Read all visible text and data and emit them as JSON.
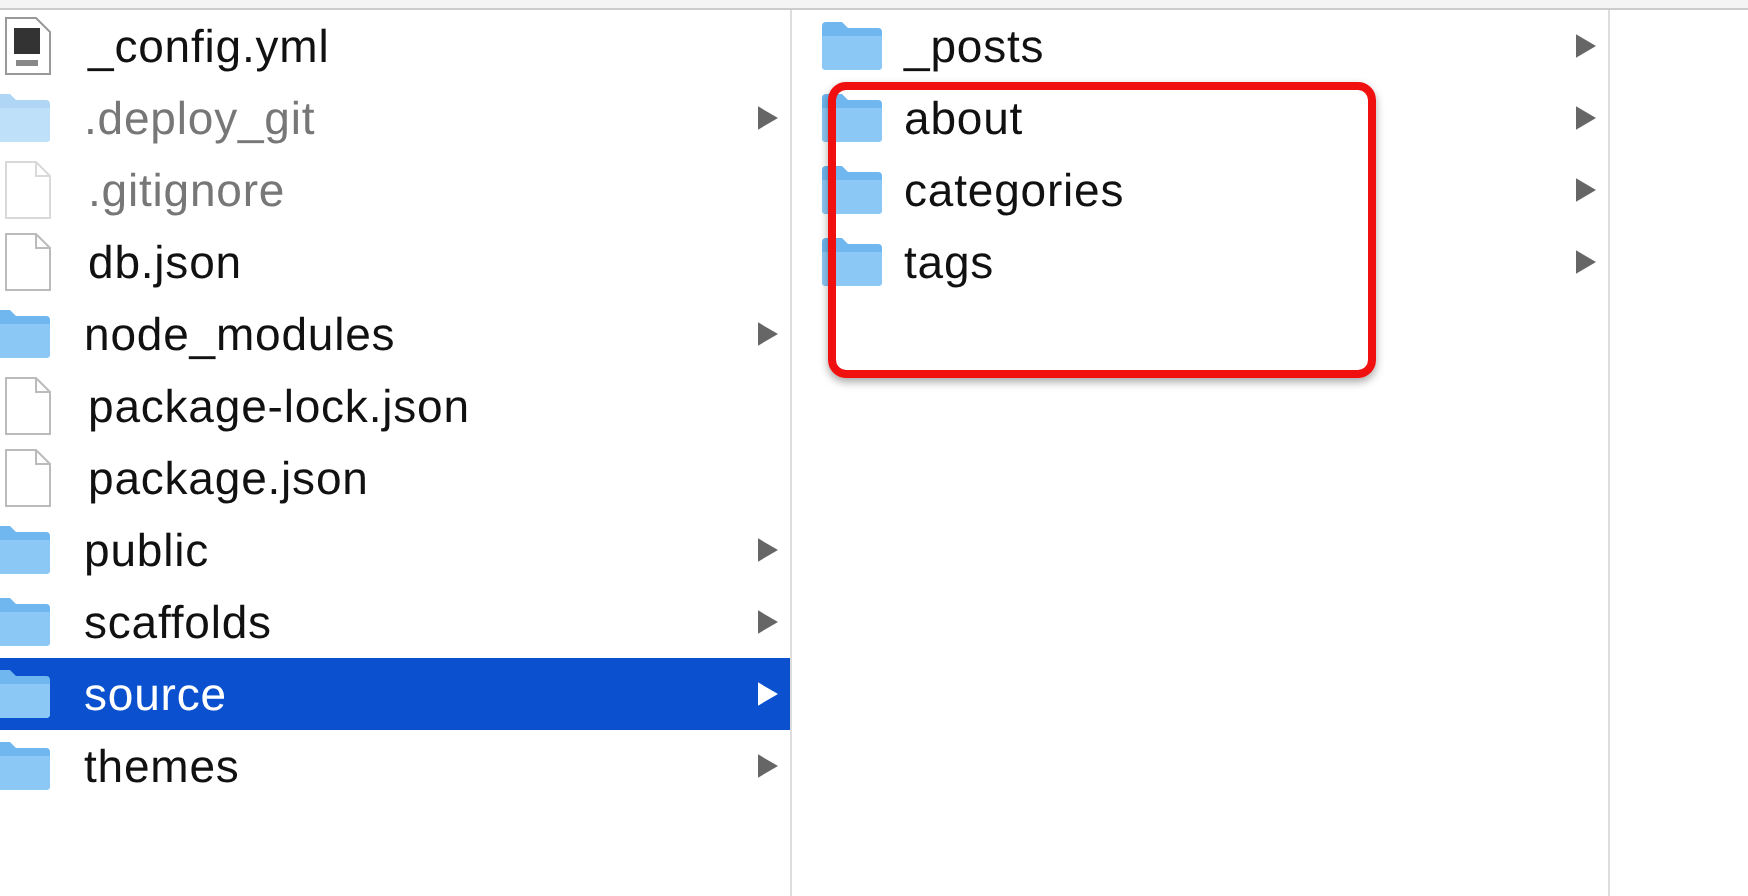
{
  "columns": [
    {
      "items": [
        {
          "name": "_config.yml",
          "kind": "yaml",
          "hidden": false,
          "selected": false,
          "has_children": false
        },
        {
          "name": ".deploy_git",
          "kind": "folder",
          "hidden": true,
          "selected": false,
          "has_children": true
        },
        {
          "name": ".gitignore",
          "kind": "file",
          "hidden": true,
          "selected": false,
          "has_children": false
        },
        {
          "name": "db.json",
          "kind": "file",
          "hidden": false,
          "selected": false,
          "has_children": false
        },
        {
          "name": "node_modules",
          "kind": "folder",
          "hidden": false,
          "selected": false,
          "has_children": true
        },
        {
          "name": "package-lock.json",
          "kind": "file",
          "hidden": false,
          "selected": false,
          "has_children": false
        },
        {
          "name": "package.json",
          "kind": "file",
          "hidden": false,
          "selected": false,
          "has_children": false
        },
        {
          "name": "public",
          "kind": "folder",
          "hidden": false,
          "selected": false,
          "has_children": true
        },
        {
          "name": "scaffolds",
          "kind": "folder",
          "hidden": false,
          "selected": false,
          "has_children": true
        },
        {
          "name": "source",
          "kind": "folder",
          "hidden": false,
          "selected": true,
          "has_children": true
        },
        {
          "name": "themes",
          "kind": "folder",
          "hidden": false,
          "selected": false,
          "has_children": true
        }
      ]
    },
    {
      "items": [
        {
          "name": "_posts",
          "kind": "folder",
          "hidden": false,
          "selected": false,
          "has_children": true
        },
        {
          "name": "about",
          "kind": "folder",
          "hidden": false,
          "selected": false,
          "has_children": true
        },
        {
          "name": "categories",
          "kind": "folder",
          "hidden": false,
          "selected": false,
          "has_children": true
        },
        {
          "name": "tags",
          "kind": "folder",
          "hidden": false,
          "selected": false,
          "has_children": true
        }
      ]
    },
    {}
  ],
  "highlight_box": true
}
